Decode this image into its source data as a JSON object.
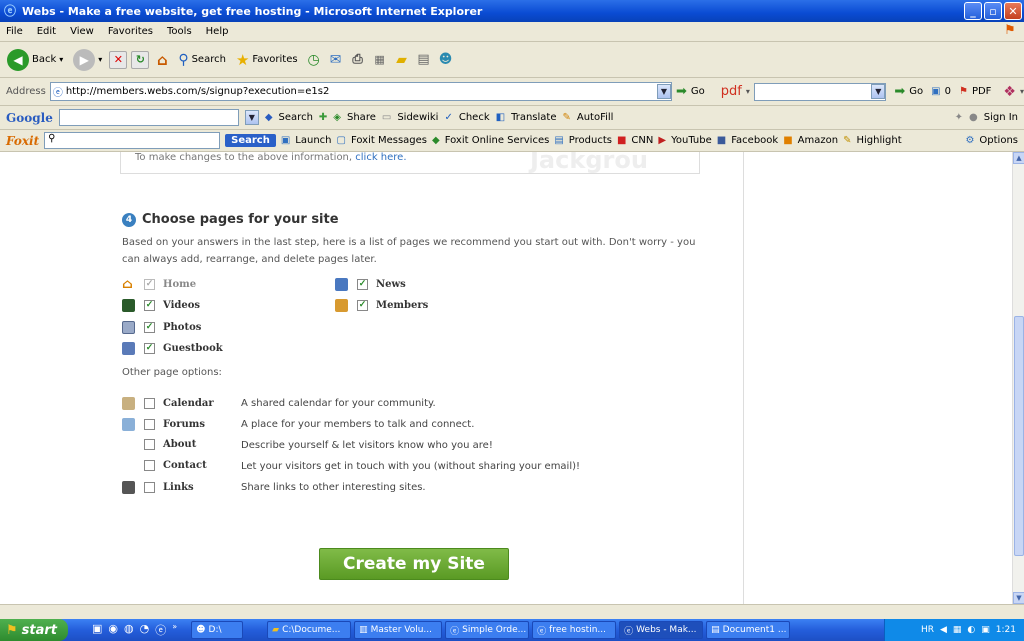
{
  "window": {
    "title": "Webs - Make a free website, get free hosting - Microsoft Internet Explorer"
  },
  "menu": [
    "File",
    "Edit",
    "View",
    "Favorites",
    "Tools",
    "Help"
  ],
  "toolbar": {
    "back": "Back",
    "search": "Search",
    "favorites": "Favorites"
  },
  "address": {
    "label": "Address",
    "url": "http://members.webs.com/s/signup?execution=e1s2",
    "go": "Go",
    "pdf_label": "pdf",
    "go2": "Go",
    "count": "0",
    "pdf": "PDF"
  },
  "google": {
    "logo": "Google",
    "search": "Search",
    "share": "Share",
    "sidewiki": "Sidewiki",
    "check": "Check",
    "translate": "Translate",
    "autofill": "AutoFill",
    "signin": "Sign In"
  },
  "foxit": {
    "logo": "Foxit",
    "search_btn": "Search",
    "launch": "Launch",
    "messages": "Foxit Messages",
    "services": "Foxit Online Services",
    "products": "Products",
    "cnn": "CNN",
    "youtube": "YouTube",
    "facebook": "Facebook",
    "amazon": "Amazon",
    "highlight": "Highlight",
    "options": "Options"
  },
  "page": {
    "note_text": "To make changes to the above information,",
    "note_link": "click here.",
    "bg_text": "Jackgrou",
    "step_number": "4",
    "section_title": "Choose pages for your site",
    "description": "Based on your answers in the last step, here is a list of pages we recommend you start out with. Don't worry - you can always add, rearrange, and delete pages later.",
    "recommended": [
      {
        "label": "Home",
        "checked": true,
        "disabled": true
      },
      {
        "label": "Videos",
        "checked": true
      },
      {
        "label": "Photos",
        "checked": true
      },
      {
        "label": "Guestbook",
        "checked": true
      },
      {
        "label": "News",
        "checked": true
      },
      {
        "label": "Members",
        "checked": true
      }
    ],
    "other_label": "Other page options:",
    "other": [
      {
        "label": "Calendar",
        "desc": "A shared calendar for your community.",
        "checked": false
      },
      {
        "label": "Forums",
        "desc": "A place for your members to talk and connect.",
        "checked": false
      },
      {
        "label": "About",
        "desc": "Describe yourself & let visitors know who you are!",
        "checked": false
      },
      {
        "label": "Contact",
        "desc": "Let your visitors get in touch with you (without sharing your email)!",
        "checked": false
      },
      {
        "label": "Links",
        "desc": "Share links to other interesting sites.",
        "checked": false
      }
    ],
    "create_button": "Create my Site"
  },
  "taskbar": {
    "start": "start",
    "tasks": [
      "D:\\",
      "C:\\Docume...",
      "Master Volu...",
      "Simple Orde...",
      "free hostin...",
      "Webs - Mak...",
      "Document1 ..."
    ],
    "lang": "HR",
    "time": "1:21"
  }
}
